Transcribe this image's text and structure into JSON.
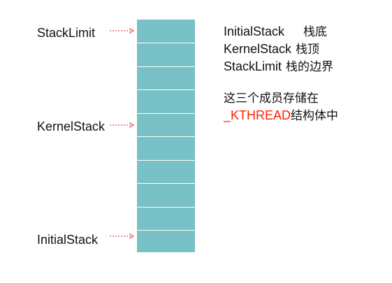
{
  "colors": {
    "stack_cell": "#78c1c6",
    "arrow": "#e02020",
    "highlight": "#ff2200",
    "text": "#111111"
  },
  "stack": {
    "cell_count": 10
  },
  "labels": {
    "stack_limit": "StackLimit",
    "kernel_stack": "KernelStack",
    "initial_stack": "InitialStack"
  },
  "info": [
    {
      "name": "InitialStack",
      "desc": "栈底"
    },
    {
      "name": "KernelStack",
      "desc": "栈顶"
    },
    {
      "name": "StackLimit",
      "desc": "栈的边界"
    }
  ],
  "note": {
    "line1": "这三个成员存储在",
    "keyword": "_KTHREAD",
    "suffix": "结构体中"
  }
}
